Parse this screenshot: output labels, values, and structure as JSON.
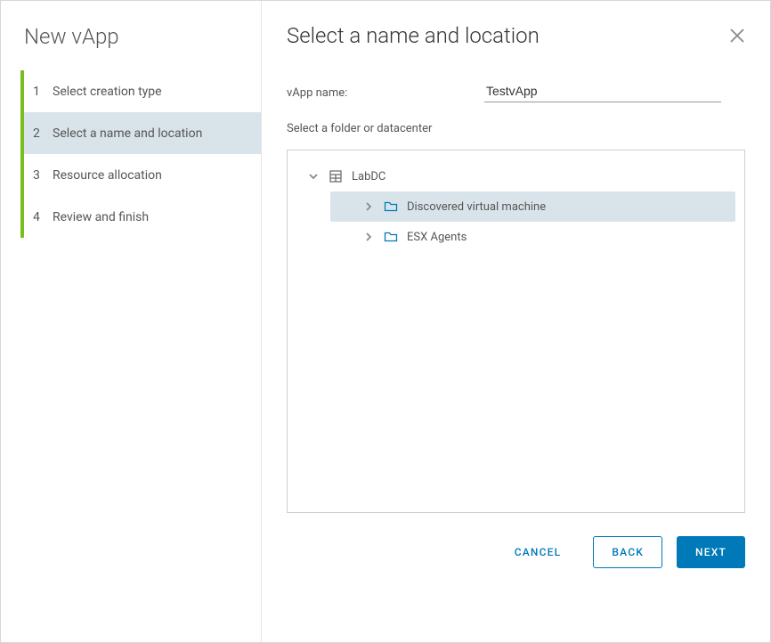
{
  "sidebar": {
    "title": "New vApp",
    "steps": [
      {
        "num": "1",
        "label": "Select creation type"
      },
      {
        "num": "2",
        "label": "Select a name and location"
      },
      {
        "num": "3",
        "label": "Resource allocation"
      },
      {
        "num": "4",
        "label": "Review and finish"
      }
    ],
    "active_index": 1
  },
  "main": {
    "title": "Select a name and location",
    "vapp_name_label": "vApp name:",
    "vapp_name_value": "TestvApp",
    "section_label": "Select a folder or datacenter"
  },
  "tree": {
    "root": {
      "label": "LabDC",
      "expanded": true
    },
    "children": [
      {
        "label": "Discovered virtual machine",
        "selected": true
      },
      {
        "label": "ESX Agents",
        "selected": false
      }
    ]
  },
  "footer": {
    "cancel": "CANCEL",
    "back": "BACK",
    "next": "NEXT"
  }
}
